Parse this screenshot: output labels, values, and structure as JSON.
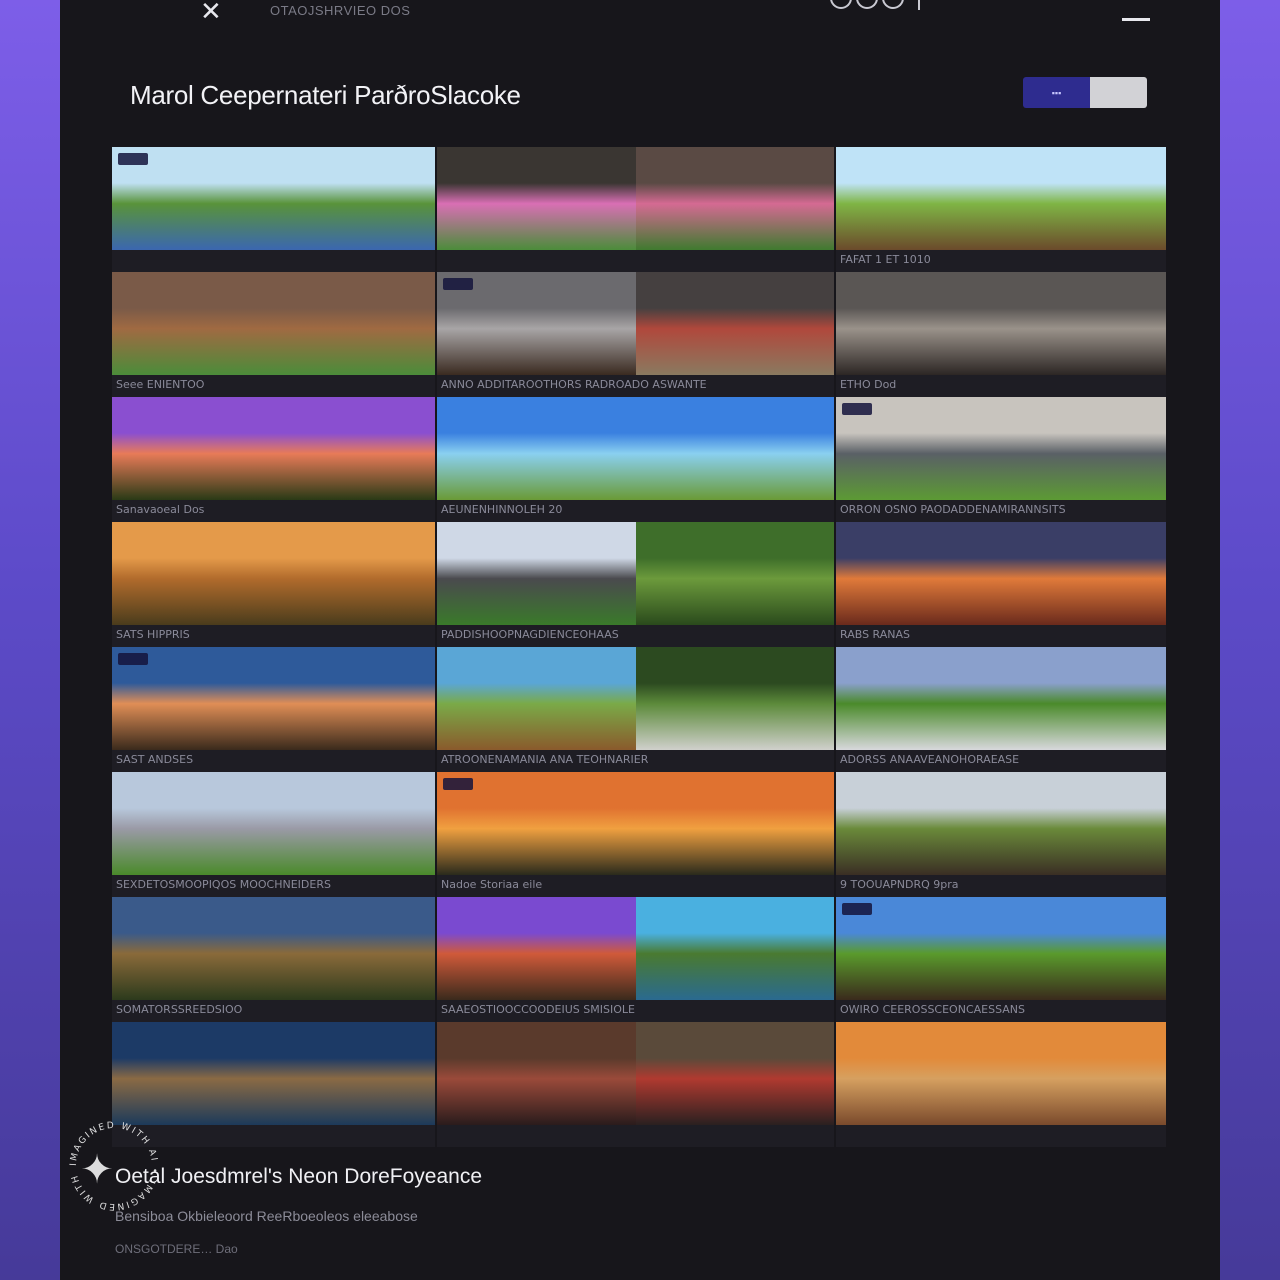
{
  "topbar": {
    "close_icon": "close-icon",
    "breadcrumb": "OTAOJSHRVIEO DOS"
  },
  "header": {
    "title": "Marol Ceepernateri ParðroSlacoke",
    "toggle_label": "▪▪▪"
  },
  "tiles": [
    {
      "caption": "",
      "palette": [
        "#bfe0f2",
        "#59933a",
        "#3b67b0"
      ],
      "split": false
    },
    {
      "caption": "",
      "palette": [
        "#3a3632",
        "#d96fb4",
        "#4b8c3a"
      ],
      "split": true,
      "palette_b": [
        "#5a4a44",
        "#d56a93",
        "#3f7a2f"
      ]
    },
    {
      "caption": "FAFAT 1 ET 1010",
      "palette": [
        "#bfe3f7",
        "#7fb545",
        "#6b4a2b"
      ],
      "split": false
    },
    {
      "caption": "Seee ENIENTOO",
      "palette": [
        "#7a5a48",
        "#a06a42",
        "#4b8c3a"
      ],
      "split": false
    },
    {
      "caption": "ANNO ADDITAROOTHORS RADROADO ASWANTE",
      "palette": [
        "#6b6a6e",
        "#a8a5a6",
        "#3a2a20"
      ],
      "split": true,
      "palette_b": [
        "#454040",
        "#b0483c",
        "#8a7a60"
      ]
    },
    {
      "caption": "ETHO Dod",
      "palette": [
        "#5a5654",
        "#9a928a",
        "#2c2624"
      ],
      "split": false
    },
    {
      "caption": "Sanavaoeal Dos",
      "palette": [
        "#8a4fd0",
        "#e87b58",
        "#2a3a16"
      ],
      "split": false
    },
    {
      "caption": "AEUNENHINNOLEH 20",
      "palette": [
        "#3a80e0",
        "#8ad0f0",
        "#6a9a36"
      ],
      "split": false
    },
    {
      "caption": "ORRON OSNO PAODADDENAMIRANNSITS",
      "palette": [
        "#c8c4be",
        "#5a6066",
        "#5c9a34"
      ],
      "split": false
    },
    {
      "caption": "SATS HIPPRIS",
      "palette": [
        "#e49a4a",
        "#b16b2c",
        "#4a3c1c"
      ],
      "split": false
    },
    {
      "caption": "PADDISHOOPNAGDIENCEOHAAS",
      "palette": [
        "#cfd8e6",
        "#4a4a4e",
        "#3a7a2a"
      ],
      "split": true,
      "palette_b": [
        "#3e6e2a",
        "#6c9a3c",
        "#2a4a1c"
      ]
    },
    {
      "caption": "RABS RANAS",
      "palette": [
        "#3a3e66",
        "#e07a3a",
        "#6a2a1c"
      ],
      "split": false
    },
    {
      "caption": "SAST ANDSES",
      "palette": [
        "#2e5a9a",
        "#e08e56",
        "#3a2a1c"
      ],
      "split": false
    },
    {
      "caption": "ATROONENAMANIA ANA TEOHNARIER",
      "palette": [
        "#5aa6d6",
        "#7aaa48",
        "#8a5a2c"
      ],
      "split": true,
      "palette_b": [
        "#2c4a20",
        "#5c8a3a",
        "#d0d0cc"
      ]
    },
    {
      "caption": "ADORSS ANAAVEANOHORAEASE",
      "palette": [
        "#8aa0cc",
        "#4a8a2a",
        "#d8d8dc"
      ],
      "split": false
    },
    {
      "caption": "SEXDETOSMOOPIQOS MOOCHNEIDERS",
      "palette": [
        "#b8c8dc",
        "#9a9aa6",
        "#4a8a2a"
      ],
      "split": false
    },
    {
      "caption": "Nadoe Storiaa eile",
      "palette": [
        "#e07230",
        "#f0a040",
        "#2a2a1c"
      ],
      "split": false
    },
    {
      "caption": "9 TOOUAPNDRQ 9pra",
      "palette": [
        "#c8d0d8",
        "#6a8a3a",
        "#3a2e24"
      ],
      "split": false
    },
    {
      "caption": "SOMATORSSREEDSIOO",
      "palette": [
        "#3a5a8a",
        "#8a6a3a",
        "#2c3a1c"
      ],
      "split": false
    },
    {
      "caption": "SAAEOSTIOOCCOODEIUS SMISIOLE",
      "palette": [
        "#7a4ad0",
        "#d05a3a",
        "#3a2a1c"
      ],
      "split": true,
      "palette_b": [
        "#4ab0e0",
        "#4a7a30",
        "#2a6a90"
      ]
    },
    {
      "caption": "OWIRO CEEROSSCEONCAESSANS",
      "palette": [
        "#4a88d8",
        "#5a9a2c",
        "#3a2a1c"
      ],
      "split": false
    },
    {
      "caption": "",
      "palette": [
        "#1c3a66",
        "#8a6a44",
        "#1c3a5a"
      ],
      "split": false
    },
    {
      "caption": "",
      "palette": [
        "#5a3a2c",
        "#9a4a3a",
        "#2a1c1c"
      ],
      "split": true,
      "palette_b": [
        "#5a4a3a",
        "#b03a30",
        "#2a2020"
      ]
    },
    {
      "caption": "",
      "palette": [
        "#e28a3a",
        "#d6a060",
        "#7a4a2c"
      ],
      "split": false
    }
  ],
  "footer": {
    "title": "Oetal Joesdmrel's Neon DoreFoyeance",
    "subtitle": "Bensiboa Okbieleoord ReeRboeoleos eleeabose",
    "meta": "ONSGOTDERE… Dao"
  },
  "seal": {
    "text": "IMAGINED WITH AI",
    "icon": "sparkle-icon"
  },
  "colors": {
    "background_top": "#7d5ee8",
    "panel": "#17161b",
    "accent": "#2e2c8f"
  }
}
